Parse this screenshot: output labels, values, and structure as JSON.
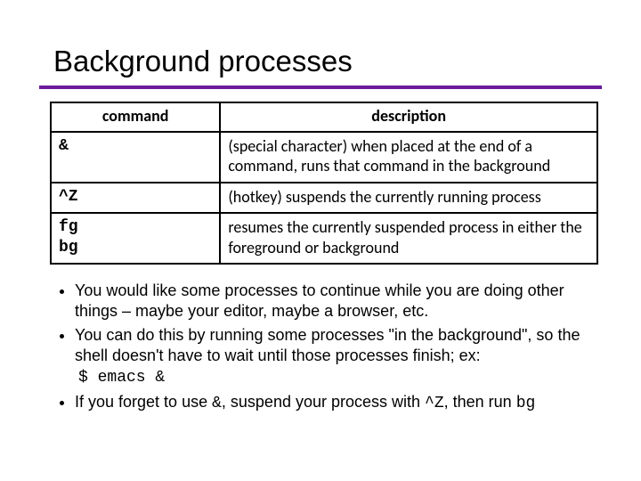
{
  "title": "Background processes",
  "table": {
    "headers": {
      "command": "command",
      "description": "description"
    },
    "rows": [
      {
        "cmd": "&",
        "desc": "(special character) when placed at the end of a command, runs that command in the background"
      },
      {
        "cmd": "^Z",
        "desc": "(hotkey) suspends the currently running process"
      },
      {
        "cmd": "fg\nbg",
        "desc": "resumes the currently suspended process in either the foreground or background"
      }
    ]
  },
  "bullets": {
    "b1": "You would like some processes to continue while you are doing other things – maybe your editor, maybe a browser, etc.",
    "b2": "You can do this by running some processes \"in the background\", so the shell doesn't have to wait until those processes finish; ex:",
    "example": "$ emacs &",
    "b3_a": "If you forget to use ",
    "b3_amp": "&",
    "b3_b": ", suspend your process with ",
    "b3_ctrlz": "^Z",
    "b3_c": ", then run ",
    "b3_bg": "bg"
  }
}
